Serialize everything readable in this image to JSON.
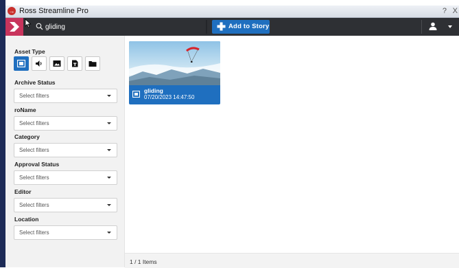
{
  "window": {
    "title": "Ross Streamline Pro",
    "help": "?",
    "close": "X"
  },
  "search": {
    "query": "gliding"
  },
  "toolbar": {
    "add_to_story_label": "Add to Story"
  },
  "sidebar": {
    "asset_type_label": "Asset Type",
    "asset_types": [
      {
        "name": "video",
        "icon": "video-icon",
        "active": true
      },
      {
        "name": "audio",
        "icon": "audio-icon",
        "active": false
      },
      {
        "name": "image",
        "icon": "image-icon",
        "active": false
      },
      {
        "name": "document",
        "icon": "document-icon",
        "active": false
      },
      {
        "name": "folder",
        "icon": "folder-icon",
        "active": false
      }
    ],
    "filters": [
      {
        "label": "Archive Status",
        "placeholder": "Select filters"
      },
      {
        "label": "roName",
        "placeholder": "Select filters"
      },
      {
        "label": "Category",
        "placeholder": "Select filters"
      },
      {
        "label": "Approval Status",
        "placeholder": "Select filters"
      },
      {
        "label": "Editor",
        "placeholder": "Select filters"
      },
      {
        "label": "Location",
        "placeholder": "Select filters"
      }
    ]
  },
  "results": {
    "items": [
      {
        "name": "gliding",
        "date": "07/20/2023 14:47:50",
        "type_icon": "video-icon"
      }
    ],
    "count_text": "1 / 1 Items"
  },
  "colors": {
    "accent": "#1f6fbf",
    "topbar": "#2e3034",
    "logo": "#c8345c",
    "sidebar": "#f2f2f2"
  }
}
